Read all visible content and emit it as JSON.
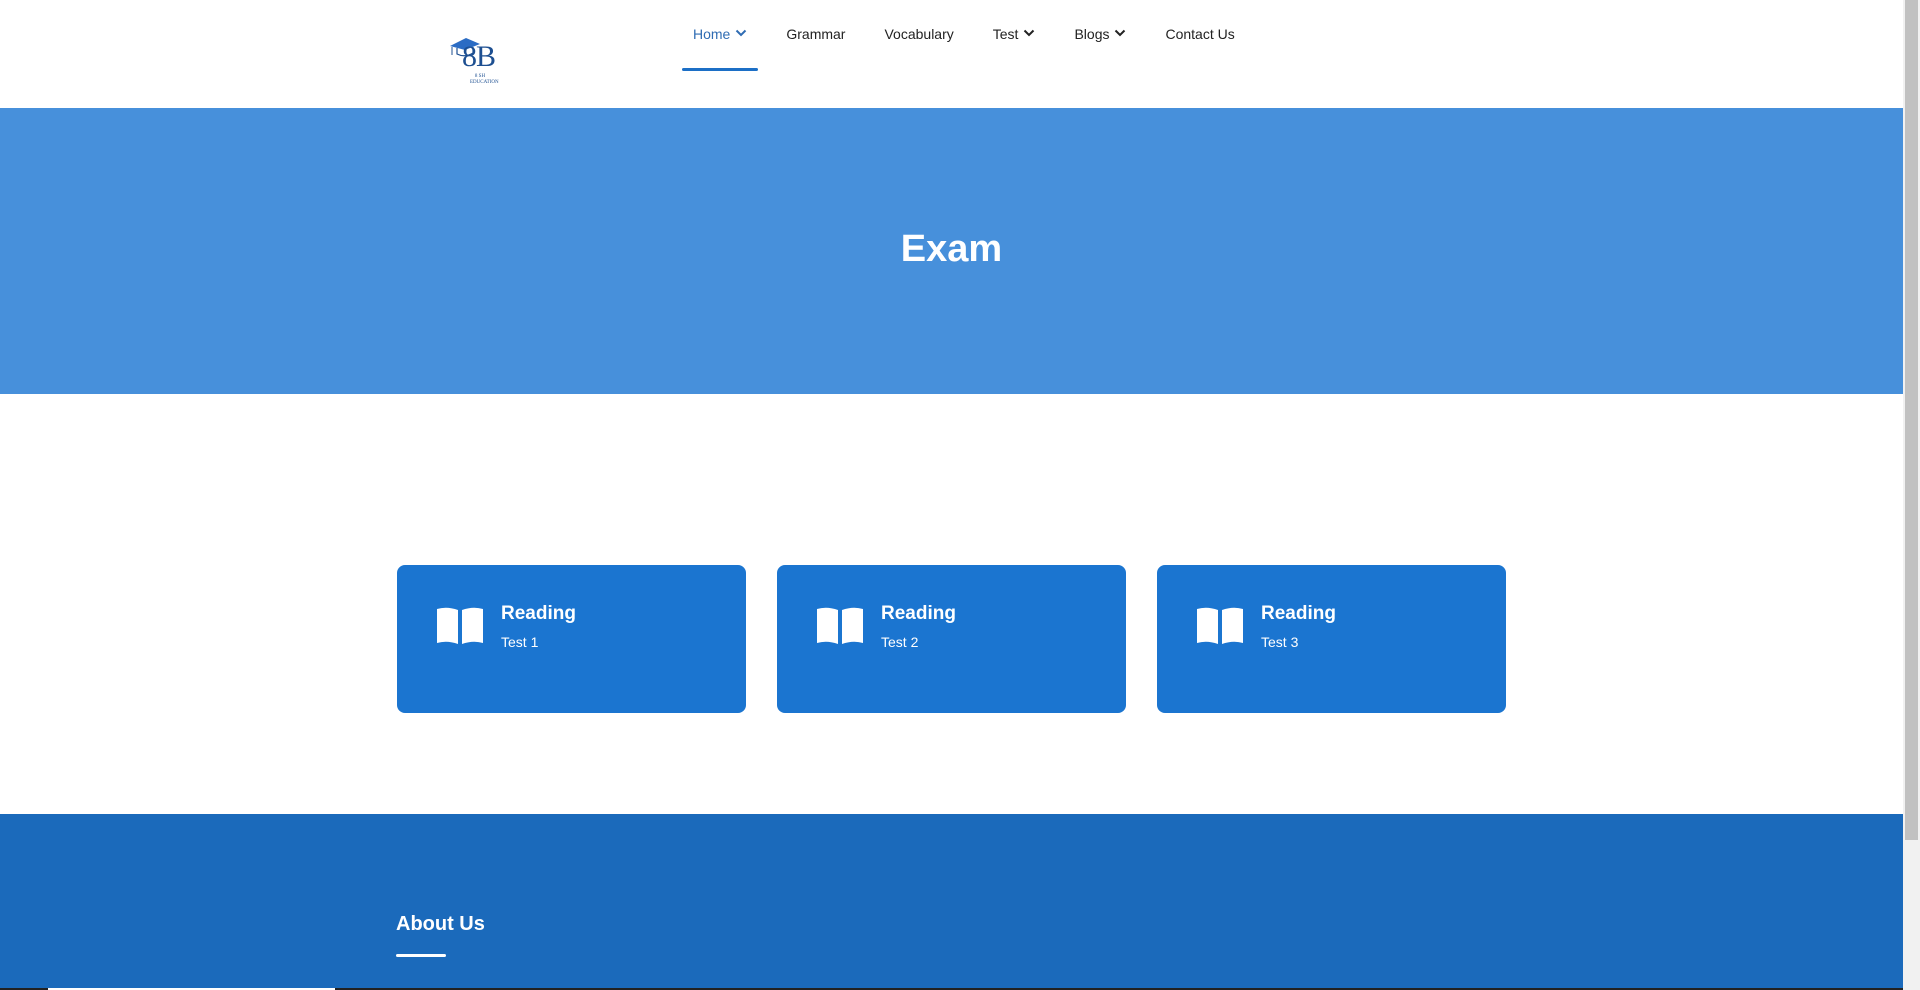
{
  "header": {
    "logo": {
      "mark": "8B",
      "sub": "8 SH EDUCATION",
      "icon": "graduation-cap-icon"
    },
    "nav": [
      {
        "label": "Home",
        "active": true,
        "dropdown": true
      },
      {
        "label": "Grammar",
        "active": false,
        "dropdown": false
      },
      {
        "label": "Vocabulary",
        "active": false,
        "dropdown": false
      },
      {
        "label": "Test",
        "active": false,
        "dropdown": true
      },
      {
        "label": "Blogs",
        "active": false,
        "dropdown": true
      },
      {
        "label": "Contact Us",
        "active": false,
        "dropdown": false
      }
    ]
  },
  "hero": {
    "title": "Exam"
  },
  "cards": [
    {
      "title": "Reading",
      "subtitle": "Test 1",
      "icon": "open-book-icon"
    },
    {
      "title": "Reading",
      "subtitle": "Test 2",
      "icon": "open-book-icon"
    },
    {
      "title": "Reading",
      "subtitle": "Test 3",
      "icon": "open-book-icon"
    }
  ],
  "footer": {
    "title": "About Us"
  },
  "colors": {
    "hero": "#4790db",
    "card": "#1b75d0",
    "footer": "#1b6abb",
    "nav_active": "#2f6cb3"
  }
}
